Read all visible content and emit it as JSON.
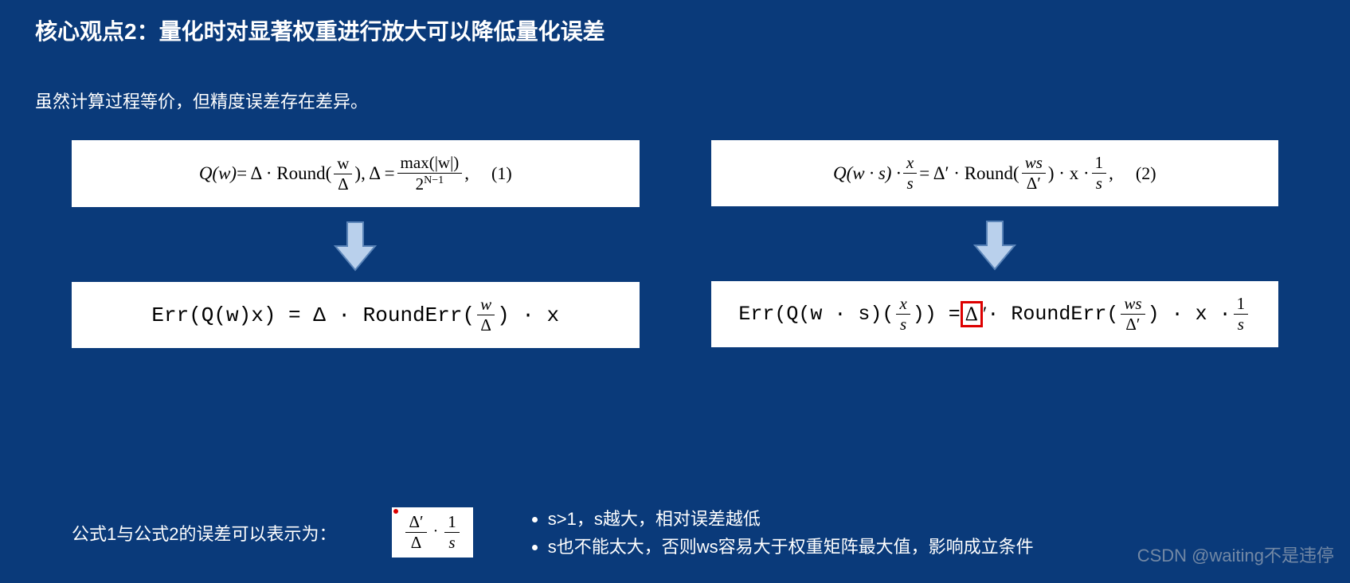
{
  "title": "核心观点2：量化时对显著权重进行放大可以降低量化误差",
  "subtitle": "虽然计算过程等价，但精度误差存在差异。",
  "formula1": {
    "lhs": "Q(w)",
    "mid": " = Δ · Round(",
    "frac_num": "w",
    "frac_den": "Δ",
    "after": "),   Δ = ",
    "frac2_num": "max(|w|)",
    "frac2_den": "2",
    "frac2_exp": "N−1",
    "tail": ",",
    "num": "(1)"
  },
  "formula2": {
    "lhs": "Q(w · s) · ",
    "fracA_num": "x",
    "fracA_den": "s",
    "mid": " = Δ′ · Round(",
    "fracB_num": "ws",
    "fracB_den": "Δ′",
    "after": ") · x · ",
    "fracC_num": "1",
    "fracC_den": "s",
    "tail": ",",
    "num": "(2)"
  },
  "err1": {
    "pre": "Err(Q(w)x) = Δ · RoundErr(",
    "frac_num": "w",
    "frac_den": "Δ",
    "post": ") · x"
  },
  "err2": {
    "pre": "Err(Q(w · s)(",
    "fracA_num": "x",
    "fracA_den": "s",
    "mid1": ")) = ",
    "delta": "Δ",
    "prime": "′",
    "mid2": " · RoundErr(",
    "fracB_num": "ws",
    "fracB_den": "Δ′",
    "mid3": ") · x · ",
    "fracC_num": "1",
    "fracC_den": "s"
  },
  "bottom": {
    "label": "公式1与公式2的误差可以表示为：",
    "frac1_num": "Δ′",
    "frac1_den": "Δ",
    "dot": " · ",
    "frac2_num": "1",
    "frac2_den": "s"
  },
  "bullets": [
    "s>1，s越大，相对误差越低",
    "s也不能太大，否则ws容易大于权重矩阵最大值，影响成立条件"
  ],
  "watermark": "CSDN @waiting不是违停"
}
